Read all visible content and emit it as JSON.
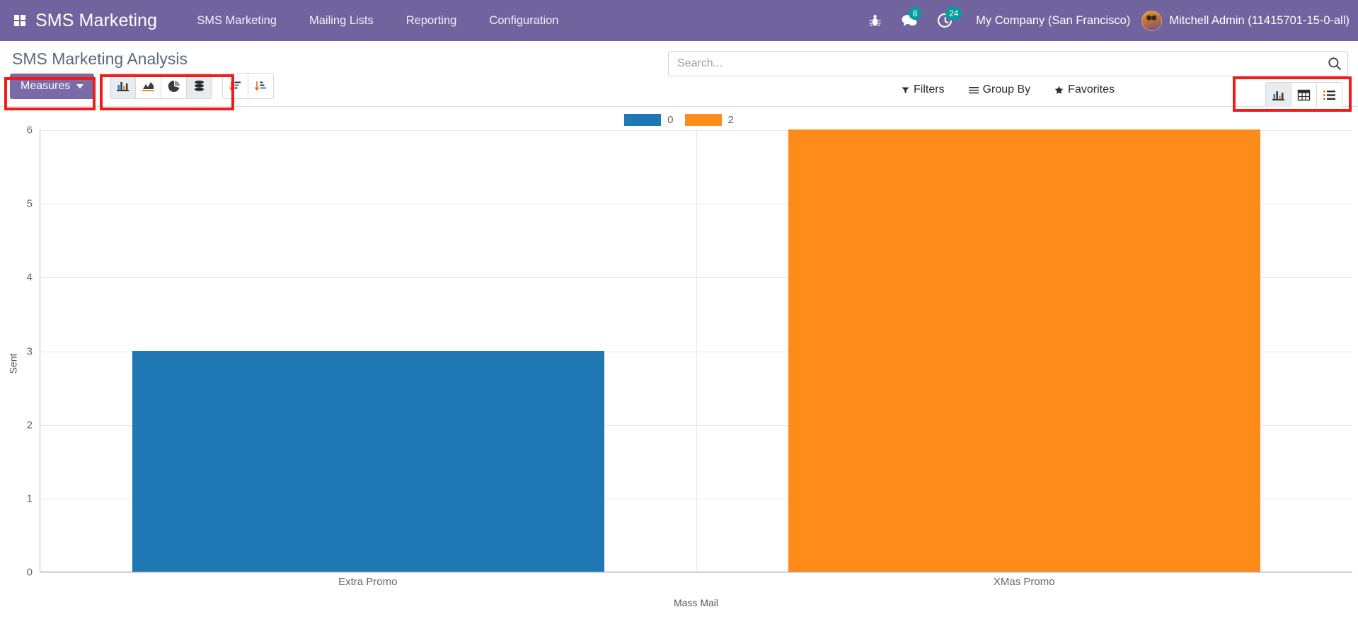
{
  "navbar": {
    "apps_icon": "apps-grid-icon",
    "brand": "SMS Marketing",
    "menu": [
      {
        "label": "SMS Marketing"
      },
      {
        "label": "Mailing Lists"
      },
      {
        "label": "Reporting"
      },
      {
        "label": "Configuration"
      }
    ],
    "bug_icon": "bug-icon",
    "messages": {
      "icon": "messages-icon",
      "badge": "8"
    },
    "activities": {
      "icon": "activity-clock-icon",
      "badge": "24"
    },
    "company": "My Company (San Francisco)",
    "user": "Mitchell Admin (11415701-15-0-all)",
    "avatar": "user-avatar"
  },
  "control_panel": {
    "title": "SMS Marketing Analysis",
    "measures_label": "Measures",
    "chart_buttons": [
      {
        "name": "bar-chart-icon",
        "active": true
      },
      {
        "name": "line-chart-icon",
        "active": false
      },
      {
        "name": "pie-chart-icon",
        "active": false
      },
      {
        "name": "stacked-chart-icon",
        "active": true
      }
    ],
    "sort_buttons": [
      {
        "name": "sort-descending-icon"
      },
      {
        "name": "sort-ascending-icon"
      }
    ],
    "view_buttons": [
      {
        "name": "graph-view-icon",
        "active": true
      },
      {
        "name": "pivot-view-icon",
        "active": false
      },
      {
        "name": "list-view-icon",
        "active": false
      }
    ]
  },
  "search": {
    "placeholder": "Search...",
    "value": "",
    "icon": "search-icon"
  },
  "filters": [
    {
      "label": "Filters",
      "icon": "filter-caret-icon"
    },
    {
      "label": "Group By",
      "icon": "group-by-lines-icon"
    },
    {
      "label": "Favorites",
      "icon": "star-icon"
    }
  ],
  "colors": {
    "brand_purple": "#71639e",
    "measures_purple": "#7a6aa8",
    "series_blue": "#1f77b4",
    "series_orange": "#ff8c1a",
    "badge_teal": "#00a09d",
    "annotation_red": "#f01c19"
  },
  "chart_data": {
    "type": "bar",
    "title": "",
    "categories": [
      "Extra Promo",
      "XMas Promo"
    ],
    "series": [
      {
        "name": "0",
        "color": "#1f77b4",
        "values": [
          3,
          0
        ]
      },
      {
        "name": "2",
        "color": "#ff8c1a",
        "values": [
          0,
          6
        ]
      }
    ],
    "xlabel": "Mass Mail",
    "ylabel": "Sent",
    "ylim": [
      0,
      6
    ],
    "yticks": [
      0,
      1,
      2,
      3,
      4,
      5,
      6
    ],
    "grid": true,
    "legend_position": "top",
    "legend": [
      {
        "label": "0",
        "color": "#1f77b4"
      },
      {
        "label": "2",
        "color": "#ff8c1a"
      }
    ]
  }
}
